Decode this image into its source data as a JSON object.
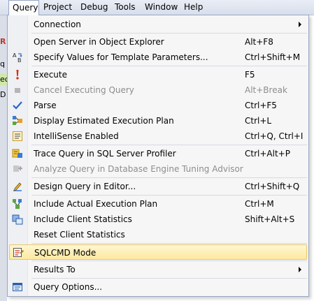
{
  "menubar": {
    "items": [
      "Query",
      "Project",
      "Debug",
      "Tools",
      "Window",
      "Help"
    ]
  },
  "background": {
    "fragments": [
      "R",
      "q",
      "ec",
      "D"
    ]
  },
  "menu": {
    "connection": {
      "label": "Connection"
    },
    "open_server": {
      "label": "Open Server in Object Explorer",
      "shortcut": "Alt+F8"
    },
    "specify_values": {
      "label": "Specify Values for Template Parameters...",
      "shortcut": "Ctrl+Shift+M"
    },
    "execute": {
      "label": "Execute",
      "shortcut": "F5"
    },
    "cancel": {
      "label": "Cancel Executing Query",
      "shortcut": "Alt+Break"
    },
    "parse": {
      "label": "Parse",
      "shortcut": "Ctrl+F5"
    },
    "display_plan": {
      "label": "Display Estimated Execution Plan",
      "shortcut": "Ctrl+L"
    },
    "intellisense": {
      "label": "IntelliSense Enabled",
      "shortcut": "Ctrl+Q, Ctrl+I"
    },
    "trace": {
      "label": "Trace Query in SQL Server Profiler",
      "shortcut": "Ctrl+Alt+P"
    },
    "analyze": {
      "label": "Analyze Query in Database Engine Tuning Advisor"
    },
    "design": {
      "label": "Design Query in Editor...",
      "shortcut": "Ctrl+Shift+Q"
    },
    "include_actual": {
      "label": "Include Actual Execution Plan",
      "shortcut": "Ctrl+M"
    },
    "include_client": {
      "label": "Include Client Statistics",
      "shortcut": "Shift+Alt+S"
    },
    "reset_client": {
      "label": "Reset Client Statistics"
    },
    "sqlcmd": {
      "label": "SQLCMD Mode"
    },
    "results_to": {
      "label": "Results To"
    },
    "query_options": {
      "label": "Query Options..."
    }
  },
  "colors": {
    "highlight": "#fde9a1",
    "menu_border": "#97a7c3",
    "disabled_text": "#8d8d8d"
  }
}
